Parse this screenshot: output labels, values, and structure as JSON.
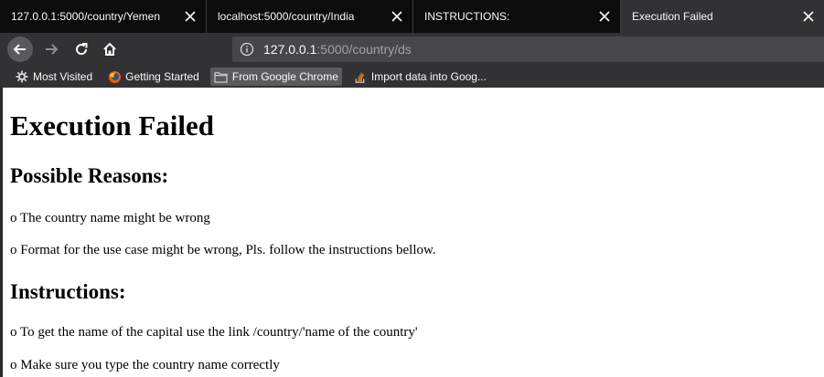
{
  "tabs": [
    {
      "title": "127.0.0.1:5000/country/Yemen",
      "active": false
    },
    {
      "title": "localhost:5000/country/India",
      "active": false
    },
    {
      "title": "INSTRUCTIONS:",
      "active": false
    },
    {
      "title": "Execution Failed",
      "active": true
    }
  ],
  "navbar": {
    "url_host": "127.0.0.1",
    "url_rest": ":5000/country/ds"
  },
  "bookmarks": [
    {
      "label": "Most Visited",
      "icon": "gear-icon"
    },
    {
      "label": "Getting Started",
      "icon": "firefox-icon"
    },
    {
      "label": "From Google Chrome",
      "icon": "folder-icon"
    },
    {
      "label": "Import data into Goog...",
      "icon": "stackoverflow-icon"
    }
  ],
  "page": {
    "heading": "Execution Failed",
    "reasons_heading": "Possible Reasons:",
    "reasons": [
      "o The country name might be wrong",
      "o Format for the use case might be wrong, Pls. follow the instructions bellow."
    ],
    "instructions_heading": "Instructions:",
    "instructions": [
      "o To get the name of the capital use the link /country/'name of the country'",
      "o Make sure you type the country name correctly"
    ]
  },
  "colors": {
    "tabstrip_bg": "#0c0c0d",
    "toolbar_bg": "#323234",
    "urlbar_bg": "#474749",
    "page_bg": "#ffffff"
  }
}
